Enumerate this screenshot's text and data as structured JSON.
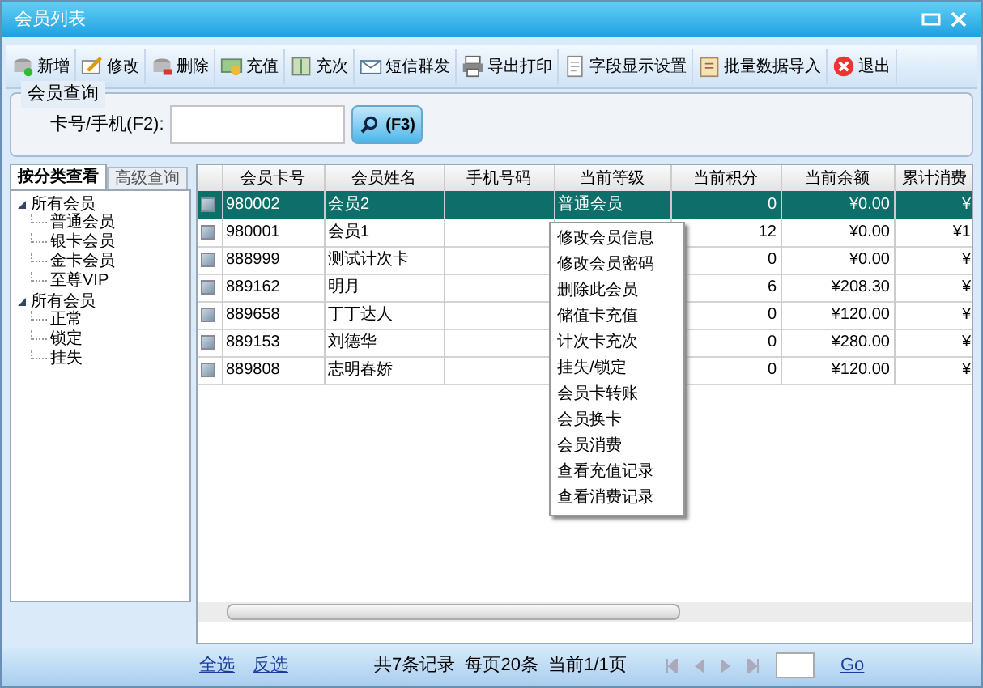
{
  "window": {
    "title": "会员列表"
  },
  "toolbar": [
    "新增",
    "修改",
    "删除",
    "充值",
    "充次",
    "短信群发",
    "导出打印",
    "字段显示设置",
    "批量数据导入",
    "退出"
  ],
  "query": {
    "legend": "会员查询",
    "label": "卡号/手机(F2):",
    "button": "(F3)"
  },
  "tabs": [
    {
      "label": "按分类查看",
      "selected": true
    },
    {
      "label": "高级查询",
      "selected": false
    }
  ],
  "tree": [
    {
      "label": "所有会员",
      "expanded": true,
      "children": [
        {
          "label": "普通会员"
        },
        {
          "label": "银卡会员"
        },
        {
          "label": "金卡会员"
        },
        {
          "label": "至尊VIP"
        }
      ]
    },
    {
      "label": "所有会员",
      "expanded": true,
      "children": [
        {
          "label": "正常"
        },
        {
          "label": "锁定"
        },
        {
          "label": "挂失"
        }
      ]
    }
  ],
  "table": {
    "columns": [
      "会员卡号",
      "会员姓名",
      "手机号码",
      "当前等级",
      "当前积分",
      "当前余额",
      "累计消费"
    ],
    "rows": [
      {
        "selected": true,
        "cells": [
          "980002",
          "会员2",
          "",
          "普通会员",
          "0",
          "¥0.00",
          "¥"
        ]
      },
      {
        "selected": false,
        "cells": [
          "980001",
          "会员1",
          "",
          "",
          "12",
          "¥0.00",
          "¥1"
        ]
      },
      {
        "selected": false,
        "cells": [
          "888999",
          "测试计次卡",
          "",
          "",
          "0",
          "¥0.00",
          "¥"
        ]
      },
      {
        "selected": false,
        "cells": [
          "889162",
          "明月",
          "",
          "",
          "6",
          "¥208.30",
          "¥"
        ]
      },
      {
        "selected": false,
        "cells": [
          "889658",
          "丁丁达人",
          "",
          "",
          "0",
          "¥120.00",
          "¥"
        ]
      },
      {
        "selected": false,
        "cells": [
          "889153",
          "刘德华",
          "",
          "",
          "0",
          "¥280.00",
          "¥"
        ]
      },
      {
        "selected": false,
        "cells": [
          "889808",
          "志明春娇",
          "",
          "",
          "0",
          "¥120.00",
          "¥"
        ]
      }
    ]
  },
  "context_menu": [
    "修改会员信息",
    "修改会员密码",
    "删除此会员",
    "储值卡充值",
    "计次卡充次",
    "挂失/锁定",
    "会员卡转账",
    "会员换卡",
    "会员消费",
    "查看充值记录",
    "查看消费记录"
  ],
  "footer": {
    "links": [
      "全选",
      "反选"
    ],
    "summary": "共7条记录  每页20条  当前1/1页",
    "go": "Go"
  }
}
